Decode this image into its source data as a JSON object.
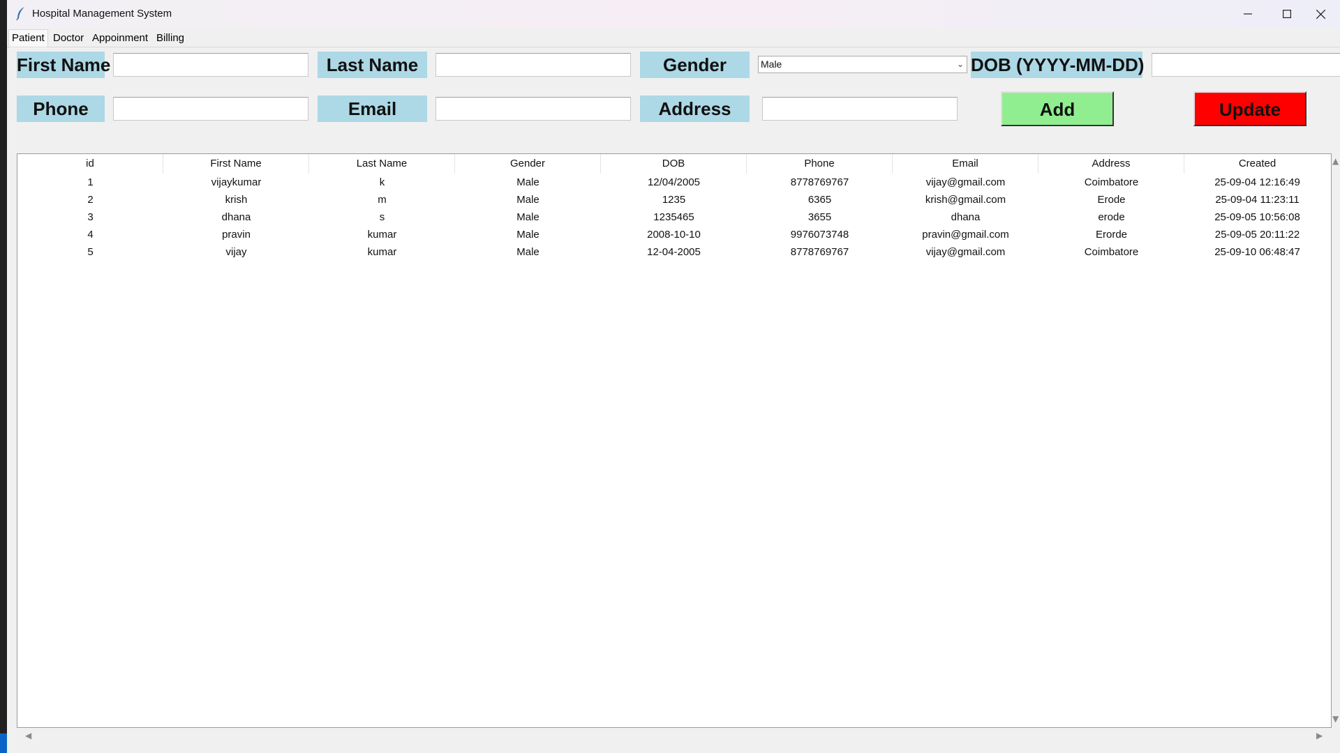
{
  "window": {
    "title": "Hospital Management System"
  },
  "tabs": [
    "Patient",
    "Doctor",
    "Appoinment",
    "Billing"
  ],
  "form": {
    "first_name_label": "First Name",
    "last_name_label": "Last Name",
    "gender_label": "Gender",
    "gender_value": "Male",
    "dob_label": "DOB (YYYY-MM-DD)",
    "phone_label": "Phone",
    "email_label": "Email",
    "address_label": "Address",
    "add_label": "Add",
    "update_label": "Update"
  },
  "table": {
    "columns": [
      "id",
      "First Name",
      "Last Name",
      "Gender",
      "DOB",
      "Phone",
      "Email",
      "Address",
      "Created"
    ],
    "rows": [
      [
        "1",
        "vijaykumar",
        "k",
        "Male",
        "12/04/2005",
        "8778769767",
        "vijay@gmail.com",
        "Coimbatore",
        "25-09-04 12:16:49"
      ],
      [
        "2",
        "krish",
        "m",
        "Male",
        "1235",
        "6365",
        "krish@gmail.com",
        "Erode",
        "25-09-04 11:23:11"
      ],
      [
        "3",
        "dhana",
        "s",
        "Male",
        "1235465",
        "3655",
        "dhana",
        "erode",
        "25-09-05 10:56:08"
      ],
      [
        "4",
        "pravin",
        "kumar",
        "Male",
        "2008-10-10",
        "9976073748",
        "pravin@gmail.com",
        "Erorde",
        "25-09-05 20:11:22"
      ],
      [
        "5",
        "vijay",
        "kumar",
        "Male",
        "12-04-2005",
        "8778769767",
        "vijay@gmail.com",
        "Coimbatore",
        "25-09-10 06:48:47"
      ]
    ]
  },
  "colors": {
    "label_bg": "#add8e6",
    "add_bg": "#90ee90",
    "update_bg": "#ff0000"
  }
}
